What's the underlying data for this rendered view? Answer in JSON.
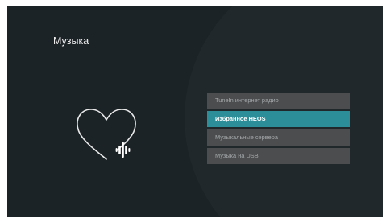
{
  "page": {
    "title": "Музыка"
  },
  "icons": {
    "hero": "heart-with-heos-logo-icon"
  },
  "menu": {
    "items": [
      {
        "label": "TuneIn интернет радио",
        "selected": false
      },
      {
        "label": "Избранное HEOS",
        "selected": true
      },
      {
        "label": "Музыкальные сервера",
        "selected": false
      },
      {
        "label": "Музыка на USB",
        "selected": false
      }
    ]
  },
  "colors": {
    "background": "#1c2327",
    "menu_item": "#4b4d4f",
    "menu_selected": "#2b8e99",
    "menu_text": "#a5a8aa",
    "selected_text": "#ffffff"
  }
}
